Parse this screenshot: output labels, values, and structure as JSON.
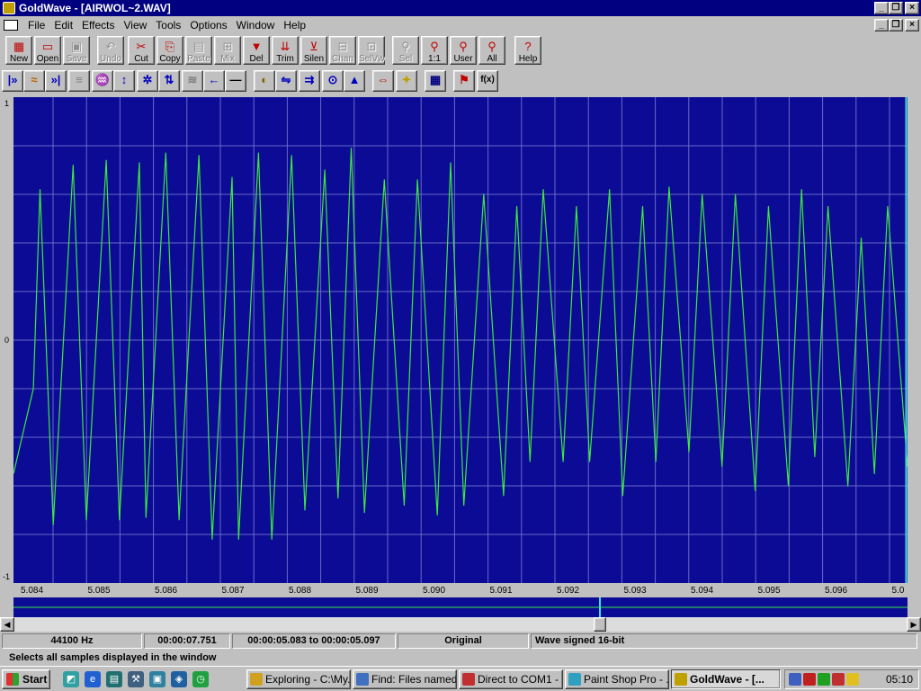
{
  "window": {
    "title": "GoldWave - [AIRWOL~2.WAV]",
    "minimize": "_",
    "maximize": "❐",
    "close": "×"
  },
  "menu": [
    {
      "label": "File"
    },
    {
      "label": "Edit"
    },
    {
      "label": "Effects"
    },
    {
      "label": "View"
    },
    {
      "label": "Tools"
    },
    {
      "label": "Options"
    },
    {
      "label": "Window"
    },
    {
      "label": "Help"
    }
  ],
  "toolbar": [
    {
      "label": "New",
      "icon": "new-icon",
      "enabled": true
    },
    {
      "label": "Open",
      "icon": "open-icon",
      "enabled": true
    },
    {
      "label": "Save",
      "icon": "save-icon",
      "enabled": false
    },
    {
      "label": "Undo",
      "icon": "undo-icon",
      "enabled": false
    },
    {
      "label": "Cut",
      "icon": "cut-icon",
      "enabled": true
    },
    {
      "label": "Copy",
      "icon": "copy-icon",
      "enabled": true
    },
    {
      "label": "Paste",
      "icon": "paste-icon",
      "enabled": false
    },
    {
      "label": "Mix",
      "icon": "mix-icon",
      "enabled": false
    },
    {
      "label": "Del",
      "icon": "delete-icon",
      "enabled": true
    },
    {
      "label": "Trim",
      "icon": "trim-icon",
      "enabled": true
    },
    {
      "label": "Silen",
      "icon": "silence-icon",
      "enabled": true
    },
    {
      "label": "Chan",
      "icon": "channel-icon",
      "enabled": false
    },
    {
      "label": "SelVw",
      "icon": "select-view-icon",
      "enabled": false
    },
    {
      "label": "Sel",
      "icon": "zoom-selection-icon",
      "enabled": false
    },
    {
      "label": "1:1",
      "icon": "zoom-1-1-icon",
      "enabled": true
    },
    {
      "label": "User",
      "icon": "zoom-user-icon",
      "enabled": true
    },
    {
      "label": "All",
      "icon": "zoom-all-icon",
      "enabled": true
    },
    {
      "label": "Help",
      "icon": "help-icon",
      "enabled": true
    }
  ],
  "effects_toolbar": [
    {
      "icon": "play-from-start-icon",
      "glyph": "|»"
    },
    {
      "icon": "waveform-icon",
      "glyph": "≈"
    },
    {
      "icon": "end-marker-icon",
      "glyph": "»|"
    },
    {
      "icon": "compress-icon",
      "glyph": "≡"
    },
    {
      "icon": "echo-icon",
      "glyph": "♒"
    },
    {
      "icon": "vertical-expand-icon",
      "glyph": "↕"
    },
    {
      "icon": "gear-icon",
      "glyph": "✲"
    },
    {
      "icon": "invert-icon",
      "glyph": "⇅"
    },
    {
      "icon": "equalizer-icon",
      "glyph": "≋"
    },
    {
      "icon": "arrow-left-icon",
      "glyph": "←"
    },
    {
      "icon": "flat-line-icon",
      "glyph": "—"
    },
    {
      "icon": "transpose-icon",
      "glyph": "◐"
    },
    {
      "icon": "reverse-icon",
      "glyph": "⇋"
    },
    {
      "icon": "forward-icon",
      "glyph": "⇉"
    },
    {
      "icon": "offset-icon",
      "glyph": "⊙"
    },
    {
      "icon": "volume-icon",
      "glyph": "▲"
    },
    {
      "icon": "resample-icon",
      "glyph": "⇔"
    },
    {
      "icon": "noise-reduction-icon",
      "glyph": "✦"
    },
    {
      "icon": "filter-icon",
      "glyph": "▦"
    },
    {
      "icon": "marker-flag-icon",
      "glyph": "⚑"
    },
    {
      "icon": "expression-icon",
      "glyph": "f(x)"
    }
  ],
  "y_axis": {
    "top": "1",
    "middle": "0",
    "bottom": "-1"
  },
  "chart_data": {
    "type": "line",
    "xlabel": "",
    "ylabel": "",
    "x_ticks": [
      "5.084",
      "5.085",
      "5.086",
      "5.087",
      "5.088",
      "5.089",
      "5.090",
      "5.091",
      "5.092",
      "5.093",
      "5.094",
      "5.095",
      "5.096",
      "5.0"
    ],
    "xlim": [
      5.0834,
      5.0969
    ],
    "ylim": [
      -1,
      1
    ],
    "grid": true,
    "series": [
      {
        "color": "#3ee83e",
        "x": [
          5.0834,
          5.0837,
          5.0838,
          5.084,
          5.0843,
          5.0845,
          5.0848,
          5.085,
          5.0853,
          5.0854,
          5.0857,
          5.0859,
          5.0862,
          5.0864,
          5.0867,
          5.0868,
          5.0871,
          5.0873,
          5.0876,
          5.0878,
          5.0881,
          5.0883,
          5.0885,
          5.0887,
          5.089,
          5.0893,
          5.0895,
          5.0898,
          5.09,
          5.0902,
          5.0905,
          5.0908,
          5.091,
          5.0912,
          5.0914,
          5.0917,
          5.0919,
          5.0921,
          5.0924,
          5.0926,
          5.0929,
          5.0931,
          5.0933,
          5.0936,
          5.0938,
          5.0941,
          5.0943,
          5.0946,
          5.0948,
          5.0951,
          5.0953,
          5.0955,
          5.0957,
          5.096,
          5.0962,
          5.0964,
          5.0966,
          5.0969
        ],
        "y": [
          -0.55,
          -0.2,
          0.62,
          -0.76,
          0.72,
          -0.74,
          0.74,
          -0.74,
          0.73,
          -0.73,
          0.77,
          -0.74,
          0.76,
          -0.82,
          0.67,
          -0.82,
          0.77,
          -0.82,
          0.76,
          -0.7,
          0.7,
          -0.65,
          0.79,
          -0.71,
          0.66,
          -0.68,
          0.66,
          -0.72,
          0.73,
          -0.68,
          0.6,
          -0.64,
          0.55,
          -0.5,
          0.62,
          -0.5,
          0.55,
          -0.5,
          0.62,
          -0.64,
          0.55,
          -0.5,
          0.63,
          -0.46,
          0.6,
          -0.52,
          0.6,
          -0.62,
          0.55,
          -0.6,
          0.62,
          -0.48,
          0.55,
          -0.6,
          0.42,
          -0.55,
          0.55,
          -0.52
        ]
      }
    ]
  },
  "status": {
    "rate": "44100 Hz",
    "length": "00:00:07.751",
    "range": "00:00:05.083 to 00:00:05.097",
    "mode": "Original",
    "format": "Wave signed 16-bit",
    "help": "Selects all samples displayed in the window"
  },
  "taskbar": {
    "start": "Start",
    "tasks": [
      {
        "label": "Exploring - C:\\My...",
        "color": "#d0a020"
      },
      {
        "label": "Find: Files named...",
        "color": "#4070c0"
      },
      {
        "label": "Direct to COM1 - ...",
        "color": "#c03030"
      },
      {
        "label": "Paint Shop Pro - ...",
        "color": "#30a0c0"
      },
      {
        "label": "GoldWave - [...",
        "color": "#c0a000"
      }
    ],
    "clock": "05:10"
  }
}
